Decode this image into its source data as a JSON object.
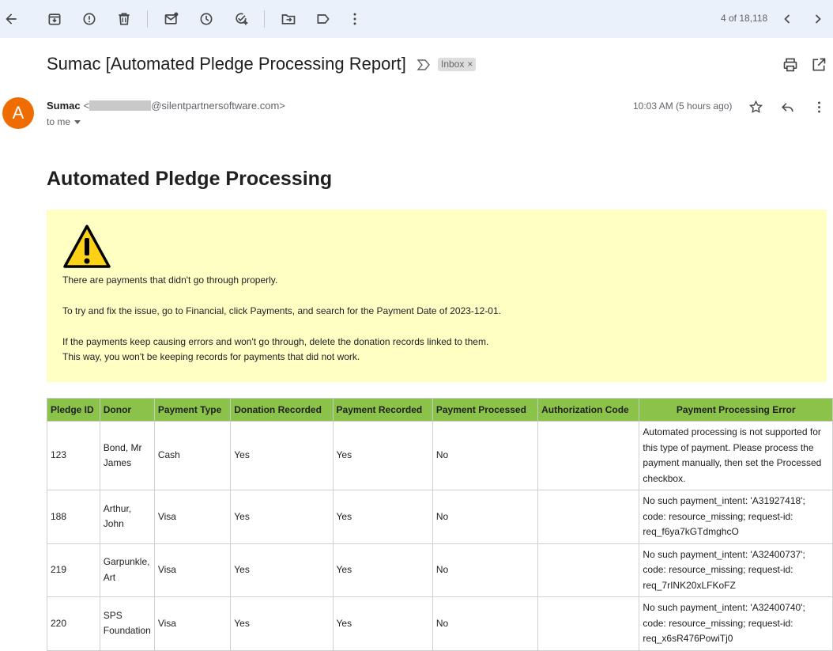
{
  "toolbar": {
    "icons": [
      "back-arrow-icon",
      "archive-icon",
      "report-spam-icon",
      "delete-icon",
      "mark-unread-icon",
      "snooze-icon",
      "add-task-icon",
      "move-to-icon",
      "label-icon",
      "more-vert-icon",
      "chevron-left-icon",
      "chevron-right-icon"
    ],
    "pager": "4 of 18,118"
  },
  "email": {
    "subject": "Sumac [Automated Pledge Processing Report]",
    "label": "Inbox",
    "label_remove": "×",
    "sender_name": "Sumac",
    "sender_open": "<",
    "sender_domain": "@silentpartnersoftware.com>",
    "recipient": "to me",
    "avatar_letter": "A",
    "avatar_color": "#ef6c00",
    "time": "10:03 AM (5 hours ago)"
  },
  "body": {
    "heading": "Automated Pledge Processing",
    "alert_bg": "#ffffc4",
    "alert_lines": [
      "There are payments that didn't go through properly.",
      "To try and fix the issue, go to Financial, click Payments, and search for the Payment Date of 2023-12-01.",
      "If the payments keep causing errors and won't go through, delete the donation records linked to them.",
      "This way, you won't be keeping records for payments that did not work."
    ]
  },
  "table": {
    "header_color": "#8bc34a",
    "headers": [
      "Pledge ID",
      "Donor",
      "Payment Type",
      "Donation Recorded",
      "Payment Recorded",
      "Payment Processed",
      "Authorization Code",
      "Payment Processing Error"
    ],
    "rows": [
      {
        "id": "123",
        "donor": "Bond, Mr James",
        "type": "Cash",
        "donation": "Yes",
        "recorded": "Yes",
        "processed": "No",
        "auth": "",
        "error": "Automated processing is not supported for this type of payment. Please process the payment manually, then set the Processed checkbox."
      },
      {
        "id": "188",
        "donor": "Arthur, John",
        "type": "Visa",
        "donation": "Yes",
        "recorded": "Yes",
        "processed": "No",
        "auth": "",
        "error": "No such payment_intent: 'A31927418'; code: resource_missing; request-id: req_f6ya7kGTdmghcO"
      },
      {
        "id": "219",
        "donor": "Garpunkle, Art",
        "type": "Visa",
        "donation": "Yes",
        "recorded": "Yes",
        "processed": "No",
        "auth": "",
        "error": "No such payment_intent: 'A32400737'; code: resource_missing; request-id: req_7rINK20xLFKoFZ"
      },
      {
        "id": "220",
        "donor": "SPS Foundation",
        "type": "Visa",
        "donation": "Yes",
        "recorded": "Yes",
        "processed": "No",
        "auth": "",
        "error": "No such payment_intent: 'A32400740'; code: resource_missing; request-id: req_x6sR476PowiTj0"
      }
    ]
  }
}
